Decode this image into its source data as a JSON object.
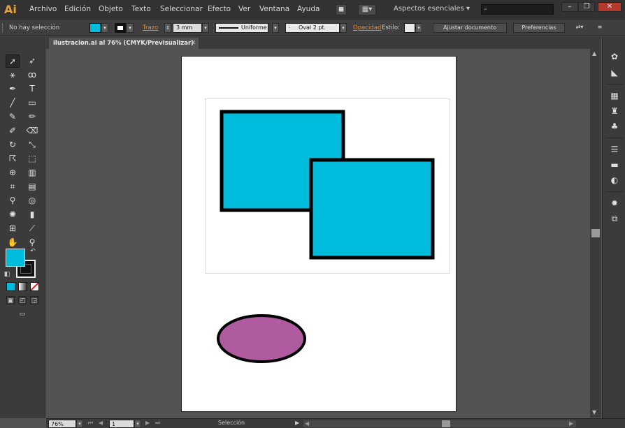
{
  "app": {
    "logo": "Ai"
  },
  "menu": [
    "Archivo",
    "Edición",
    "Objeto",
    "Texto",
    "Seleccionar",
    "Efecto",
    "Ver",
    "Ventana",
    "Ayuda"
  ],
  "workspace": "Aspectos esenciales",
  "control": {
    "selection_status": "No hay selección",
    "fill_color": "#00bcdc",
    "stroke_label": "Trazo",
    "stroke_weight": "3 mm",
    "stroke_profile": "Uniforme",
    "brush": "Oval 2 pt.",
    "opacity_label": "Opacidad",
    "style_label": "Estilo:",
    "arrange_button": "Ajustar documento",
    "prefs_button": "Preferencias"
  },
  "document": {
    "tab_title": "ilustracion.ai al 76% (CMYK/Previsualizar)"
  },
  "artwork": {
    "rect_color": "#00bcdc",
    "ellipse_color": "#b05aa0",
    "stroke_color": "#000000"
  },
  "status": {
    "zoom": "76%",
    "page": "1",
    "tool": "Selección"
  },
  "icons": {
    "tools": [
      "selection-tool",
      "direct-selection-tool",
      "magic-wand-tool",
      "lasso-tool",
      "pen-tool",
      "type-tool",
      "line-tool",
      "rectangle-tool",
      "paintbrush-tool",
      "pencil-tool",
      "blob-brush-tool",
      "eraser-tool",
      "rotate-tool",
      "scale-tool",
      "warp-tool",
      "free-transform-tool",
      "shape-builder-tool",
      "perspective-grid-tool",
      "mesh-tool",
      "gradient-tool",
      "eyedropper-tool",
      "blend-tool",
      "symbol-sprayer-tool",
      "column-graph-tool",
      "artboard-tool",
      "slice-tool",
      "hand-tool",
      "zoom-tool"
    ],
    "panels": [
      "color-panel",
      "color-guide-panel",
      "swatches-panel",
      "brushes-panel",
      "symbols-panel",
      "stroke-panel",
      "gradient-panel",
      "transparency-panel",
      "appearance-panel",
      "graphic-styles-panel"
    ]
  }
}
